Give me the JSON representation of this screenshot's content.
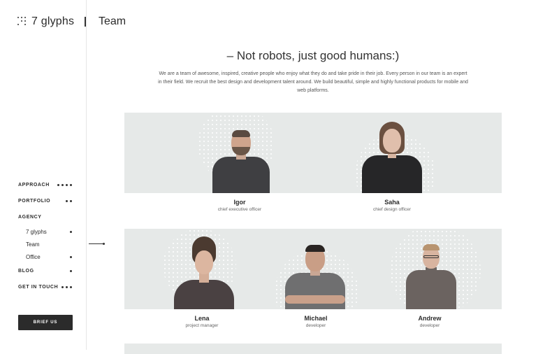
{
  "brand": {
    "name": "7 glyphs"
  },
  "header": {
    "title": "Team"
  },
  "nav": {
    "approach": "APPROACH",
    "portfolio": "PORTFOLIO",
    "agency": "AGENCY",
    "agency_items": [
      "7 glyphs",
      "Team",
      "Office"
    ],
    "blog": "BLOG",
    "contact": "GET IN TOUCH",
    "active": "Team"
  },
  "cta": {
    "brief": "BRIEF US"
  },
  "content": {
    "headline": "– Not robots, just good humans:)",
    "intro": "We are a team of awesome, inspired, creative people who enjoy what they do and take pride in their job. Every person in our team is an expert in their field. We recruit the best design and development talent around. We build beautiful, simple and highly functional products for mobile and web platforms."
  },
  "team": [
    {
      "name": "Igor",
      "role": "chief executive officer"
    },
    {
      "name": "Saha",
      "role": "chief design officer"
    },
    {
      "name": "Lena",
      "role": "project manager"
    },
    {
      "name": "Michael",
      "role": "developer"
    },
    {
      "name": "Andrew",
      "role": "developer"
    }
  ]
}
